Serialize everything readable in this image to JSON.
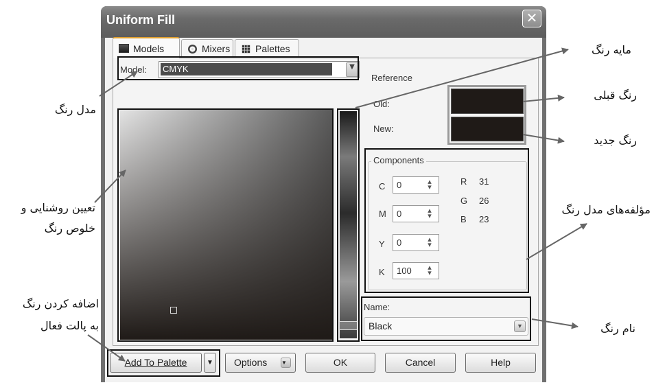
{
  "dialog": {
    "title": "Uniform Fill",
    "close_glyph": "✕"
  },
  "tabs": [
    {
      "label": "Models",
      "icon": "models-icon"
    },
    {
      "label": "Mixers",
      "icon": "mixers-icon"
    },
    {
      "label": "Palettes",
      "icon": "palettes-icon"
    }
  ],
  "model": {
    "label": "Model:",
    "value": "CMYK"
  },
  "reference": {
    "title": "Reference",
    "old_label": "Old:",
    "new_label": "New:",
    "old_color": "#1f1a17",
    "new_color": "#1f1a17"
  },
  "components": {
    "title": "Components",
    "cmyk": [
      {
        "label": "C",
        "value": "0"
      },
      {
        "label": "M",
        "value": "0"
      },
      {
        "label": "Y",
        "value": "0"
      },
      {
        "label": "K",
        "value": "100"
      }
    ],
    "rgb": [
      {
        "label": "R",
        "value": "31"
      },
      {
        "label": "G",
        "value": "26"
      },
      {
        "label": "B",
        "value": "23"
      }
    ]
  },
  "name": {
    "label": "Name:",
    "value": "Black"
  },
  "buttons": {
    "add_to_palette": "Add To Palette",
    "options": "Options",
    "ok": "OK",
    "cancel": "Cancel",
    "help": "Help"
  },
  "annotations": {
    "hue": "مایه رنگ",
    "old_color": "رنگ قبلی",
    "new_color": "رنگ جدید",
    "color_model": "مدل رنگ",
    "brightness_line1": "تعیین روشنایی و",
    "brightness_line2": "خلوص رنگ",
    "components": "مؤلفه‌های مدل رنگ",
    "add_line1": "اضافه کردن رنگ",
    "add_line2": "به پالت فعال",
    "color_name": "نام رنگ"
  }
}
